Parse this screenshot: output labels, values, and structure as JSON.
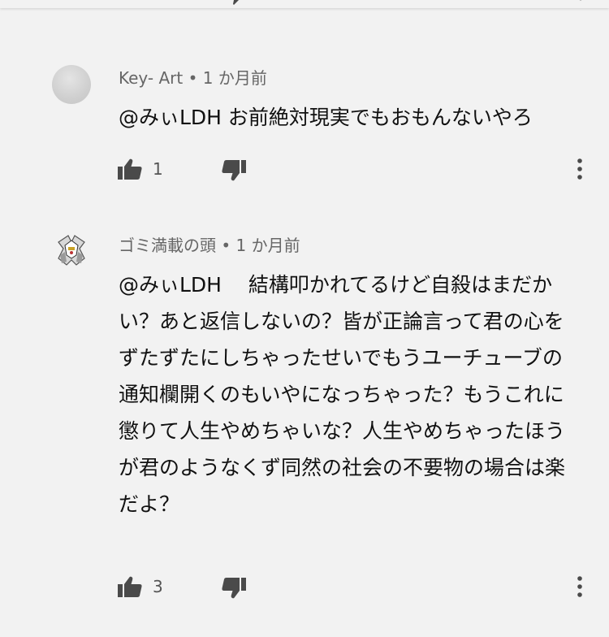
{
  "comments": [
    {
      "author": "Key- Art",
      "separator": "•",
      "time": "1 か月前",
      "text": "@みぃLDH お前絶対現実でもおもんないやろ",
      "likes": "1",
      "avatar": "gray-circle-avatar"
    },
    {
      "author": "ゴミ満載の頭",
      "separator": "•",
      "time": "1 か月前",
      "text": "@みぃLDH　 結構叩かれてるけど自殺はまだかい？あと返信しないの？皆が正論言って君の心をずたずたにしちゃったせいでもうユーチューブの通知欄開くのもいやになっちゃった？もうこれに懲りて人生やめちゃいな？人生やめちゃったほうが君のようなくず同然の社会の不要物の場合は楽だよ？",
      "likes": "3",
      "avatar": "robot-avatar"
    }
  ],
  "icons": {
    "like": "thumbs-up-icon",
    "dislike": "thumbs-down-icon",
    "more": "more-vert-icon"
  },
  "colors": {
    "background": "#f2f2f2",
    "meta_text": "#666666",
    "body_text": "#111111",
    "icon": "#4a4a4a"
  }
}
